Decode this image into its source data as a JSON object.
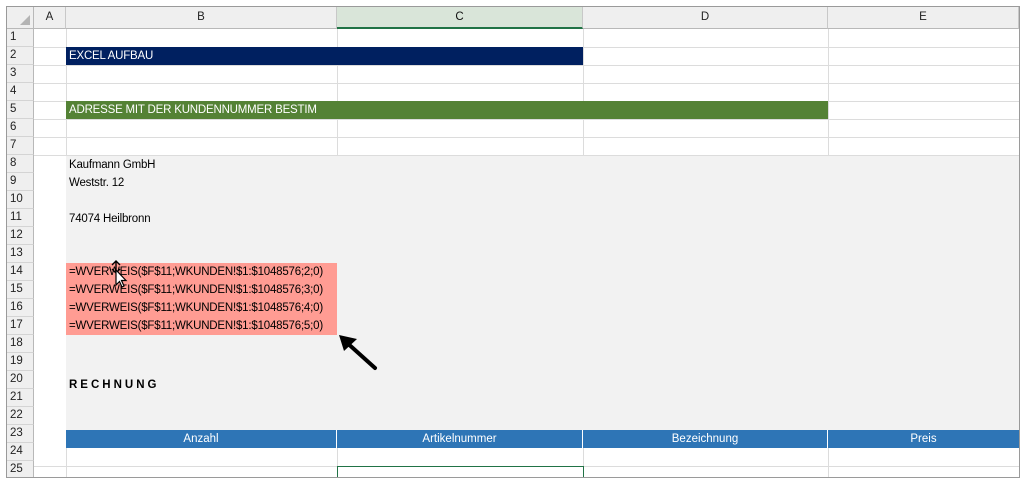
{
  "columns": [
    "A",
    "B",
    "C",
    "D",
    "E"
  ],
  "selected_column": "C",
  "rows": [
    "1",
    "2",
    "3",
    "4",
    "5",
    "6",
    "7",
    "8",
    "9",
    "10",
    "11",
    "12",
    "13",
    "14",
    "15",
    "16",
    "17",
    "18",
    "19",
    "20",
    "21",
    "22",
    "23",
    "24",
    "25"
  ],
  "cells": {
    "b2": "EXCEL AUFBAU",
    "b5": "ADRESSE MIT DER KUNDENNUMMER BESTIM",
    "b8": "Kaufmann GmbH",
    "b9": "Weststr. 12",
    "b11": "74074 Heilbronn",
    "b14": "=WVERWEIS($F$11;WKUNDEN!$1:$1048576;2;0)",
    "b15": "=WVERWEIS($F$11;WKUNDEN!$1:$1048576;3;0)",
    "b16": "=WVERWEIS($F$11;WKUNDEN!$1:$1048576;4;0)",
    "b17": "=WVERWEIS($F$11;WKUNDEN!$1:$1048576;5;0)",
    "b20": "RECHNUNG"
  },
  "table_header": [
    "Anzahl",
    "Artikelnummer",
    "Bezeichnung",
    "Preis"
  ],
  "colors": {
    "title_banner": "#002060",
    "section_banner": "#548235",
    "formula_highlight": "#ff9c93",
    "table_header": "#2e75b6",
    "background_block": "#f2f2f2"
  },
  "icons": [
    "move-cursor-icon",
    "annotation-arrow-icon"
  ]
}
